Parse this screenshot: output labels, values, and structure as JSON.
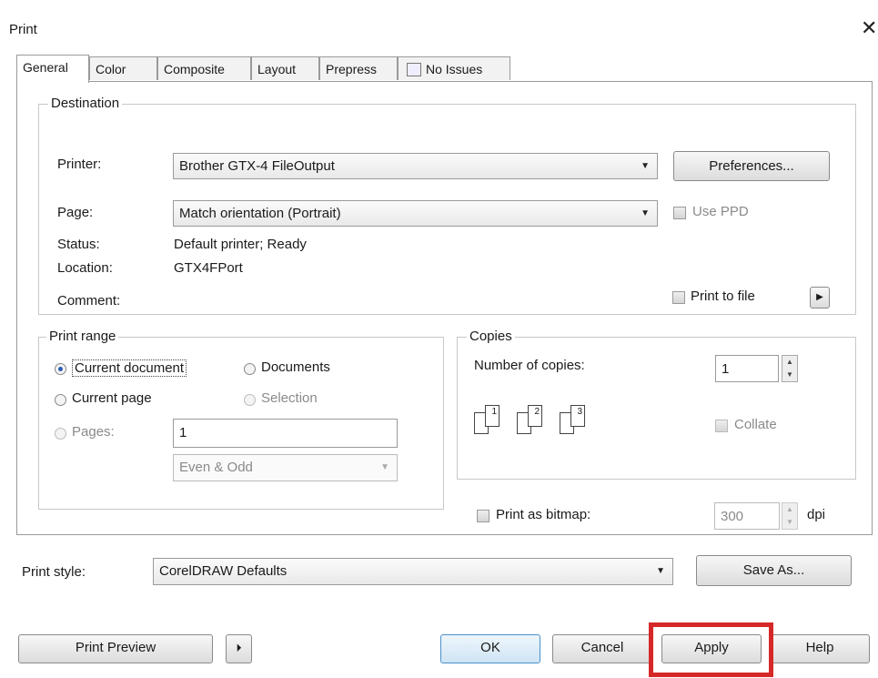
{
  "window": {
    "title": "Print",
    "close": "✕"
  },
  "tabs": [
    "General",
    "Color",
    "Composite",
    "Layout",
    "Prepress",
    "No Issues"
  ],
  "destination": {
    "legend": "Destination",
    "printer_label": "Printer:",
    "printer_value": "Brother GTX-4 FileOutput",
    "preferences_button": "Preferences...",
    "page_label": "Page:",
    "page_value": "Match orientation (Portrait)",
    "use_ppd": "Use PPD",
    "status_label": "Status:",
    "status_value": "Default printer; Ready",
    "location_label": "Location:",
    "location_value": "GTX4FPort",
    "comment_label": "Comment:",
    "print_to_file": "Print to file"
  },
  "print_range": {
    "legend": "Print range",
    "current_document": "Current document",
    "documents": "Documents",
    "current_page": "Current page",
    "selection": "Selection",
    "pages_label": "Pages:",
    "pages_value": "1",
    "even_odd": "Even & Odd"
  },
  "copies": {
    "legend": "Copies",
    "number_label": "Number of copies:",
    "number_value": "1",
    "collate": "Collate"
  },
  "bitmap": {
    "label": "Print as bitmap:",
    "dpi_value": "300",
    "dpi_unit": "dpi"
  },
  "print_style": {
    "label": "Print style:",
    "value": "CorelDRAW Defaults",
    "save_as": "Save As..."
  },
  "footer": {
    "print_preview": "Print Preview",
    "ok": "OK",
    "cancel": "Cancel",
    "apply": "Apply",
    "help": "Help"
  },
  "colors": {
    "highlight": "#d62828",
    "radio_selected": "#2a5db0"
  }
}
